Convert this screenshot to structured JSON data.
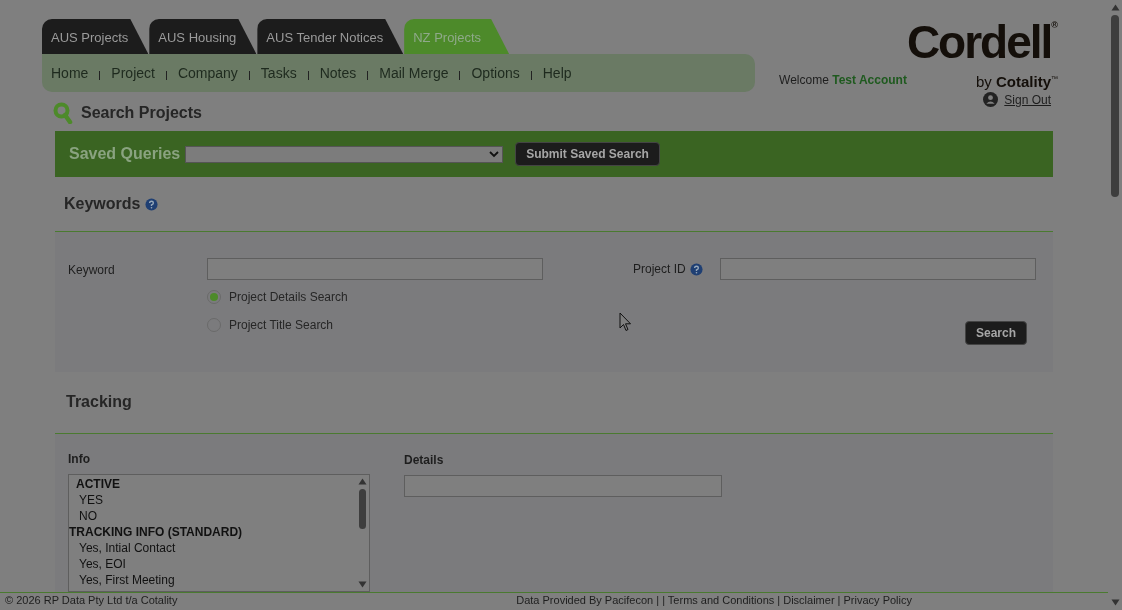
{
  "tabs": [
    {
      "label": "AUS Projects",
      "selected": false
    },
    {
      "label": "AUS Housing",
      "selected": false
    },
    {
      "label": "AUS Tender Notices",
      "selected": false
    },
    {
      "label": "NZ Projects",
      "selected": true
    }
  ],
  "nav": [
    "Home",
    "Project",
    "Company",
    "Tasks",
    "Notes",
    "Mail Merge",
    "Options",
    "Help"
  ],
  "logo": {
    "name": "Cordell$^{®}$",
    "byline": "by **Cotality**$^{™}$"
  },
  "welcome": {
    "prefix": "Welcome",
    "user": "Test Account"
  },
  "sign_out": "Sign Out",
  "page_title": "Search Projects",
  "saved_queries": {
    "label": "Saved Queries",
    "button": "Submit Saved Search"
  },
  "keywords": {
    "title": "Keywords",
    "keyword_label": "Keyword",
    "radios": [
      {
        "label": "Project Details Search",
        "selected": true
      },
      {
        "label": "Project Title Search",
        "selected": false
      }
    ],
    "project_id_label": "Project ID",
    "search_button": "Search"
  },
  "tracking": {
    "title": "Tracking",
    "info_label": "Info",
    "details_label": "Details",
    "info_options": [
      {
        "label": "ACTIVE",
        "kind": "heading"
      },
      {
        "label": "YES",
        "kind": "option"
      },
      {
        "label": "NO",
        "kind": "option"
      },
      {
        "label": "TRACKING INFO (STANDARD)",
        "kind": "group"
      },
      {
        "label": "Yes, Intial Contact",
        "kind": "option"
      },
      {
        "label": "Yes, EOI",
        "kind": "option"
      },
      {
        "label": "Yes, First Meeting",
        "kind": "option"
      }
    ]
  },
  "footer": {
    "copyright": "© 2026 RP Data Pty Ltd t/a Cotality",
    "links": "Data Provided By Pacifecon | | Terms and Conditions | Disclaimer | Privacy Policy"
  }
}
